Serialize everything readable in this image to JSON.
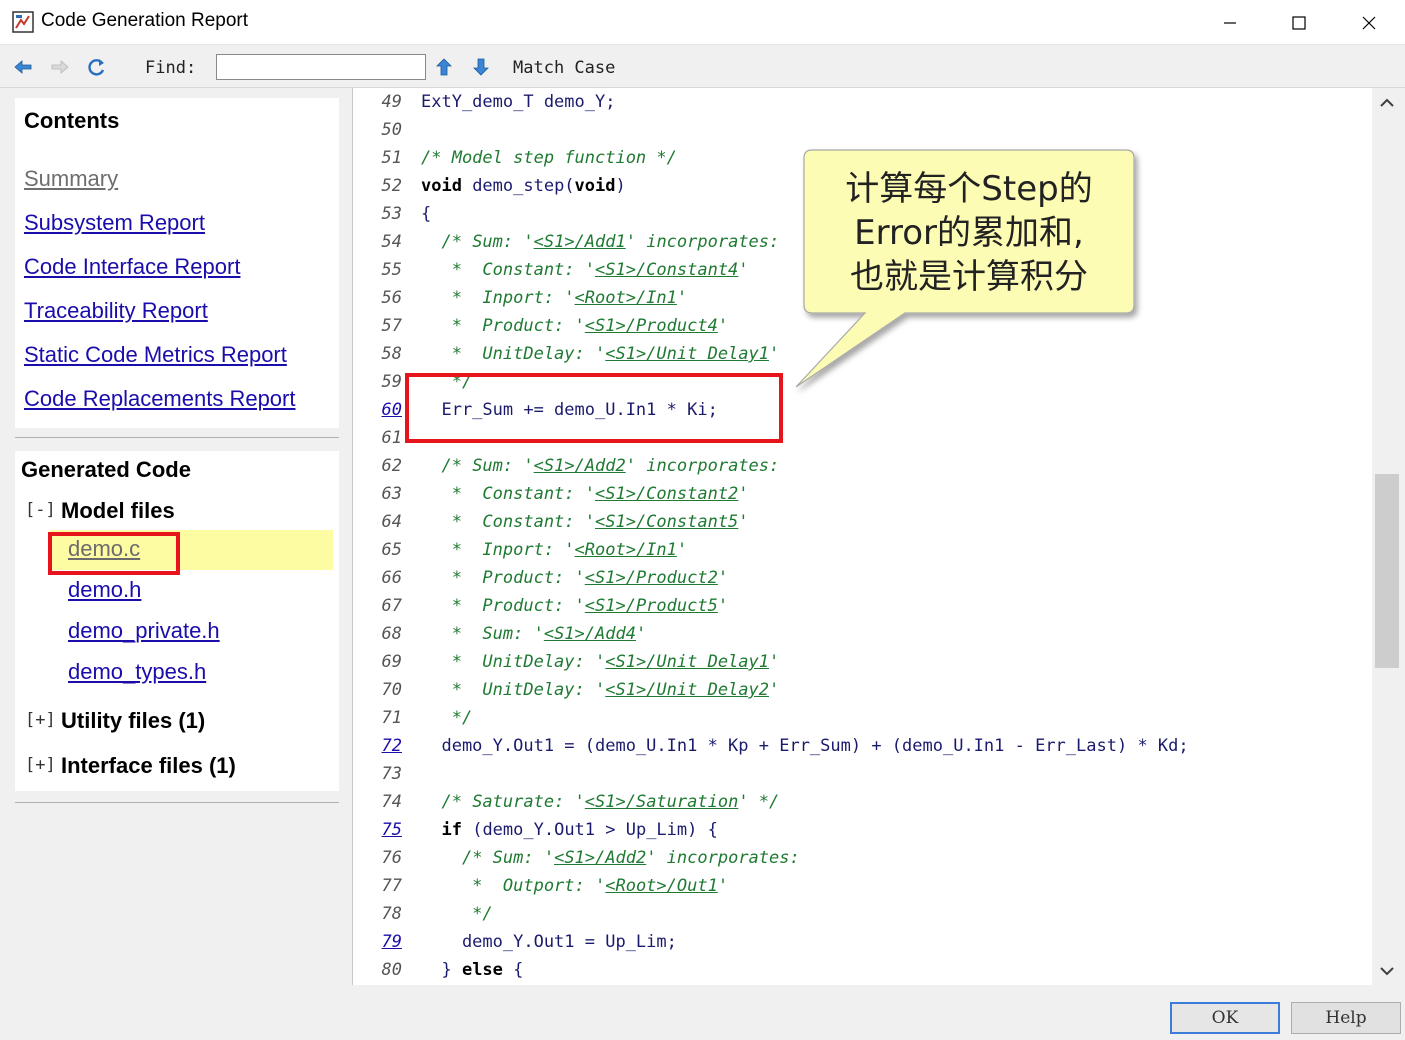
{
  "window": {
    "title": "Code Generation Report"
  },
  "toolbar": {
    "find_label": "Find:",
    "find_value": "",
    "match_case_label": "Match Case"
  },
  "contents": {
    "heading": "Contents",
    "links": [
      {
        "label": "Summary"
      },
      {
        "label": "Subsystem Report"
      },
      {
        "label": "Code Interface Report"
      },
      {
        "label": "Traceability Report"
      },
      {
        "label": "Static Code Metrics Report"
      },
      {
        "label": "Code Replacements Report"
      }
    ]
  },
  "generated_code": {
    "heading": "Generated Code",
    "model_files": {
      "toggle": "[-]",
      "label": "Model files",
      "files": [
        "demo.c",
        "demo.h",
        "demo_private.h",
        "demo_types.h"
      ]
    },
    "utility_files": {
      "toggle": "[+]",
      "label": "Utility files (1)"
    },
    "interface_files": {
      "toggle": "[+]",
      "label": "Interface files (1)"
    }
  },
  "code": {
    "lines": [
      {
        "n": "49",
        "link": false,
        "segs": [
          [
            "p",
            "ExtY_demo_T demo_Y;"
          ]
        ]
      },
      {
        "n": "50",
        "link": false,
        "segs": []
      },
      {
        "n": "51",
        "link": false,
        "segs": [
          [
            "c",
            "/* Model step function */"
          ]
        ]
      },
      {
        "n": "52",
        "link": false,
        "segs": [
          [
            "k",
            "void"
          ],
          [
            "p",
            " demo_step("
          ],
          [
            "k",
            "void"
          ],
          [
            "p",
            ")"
          ]
        ]
      },
      {
        "n": "53",
        "link": false,
        "segs": [
          [
            "p",
            "{"
          ]
        ]
      },
      {
        "n": "54",
        "link": false,
        "segs": [
          [
            "p",
            "  "
          ],
          [
            "c",
            "/* Sum: '"
          ],
          [
            "l",
            "<S1>/Add1"
          ],
          [
            "c",
            "' incorporates:"
          ]
        ]
      },
      {
        "n": "55",
        "link": false,
        "segs": [
          [
            "c",
            "   *  Constant: '"
          ],
          [
            "l",
            "<S1>/Constant4"
          ],
          [
            "c",
            "'"
          ]
        ]
      },
      {
        "n": "56",
        "link": false,
        "segs": [
          [
            "c",
            "   *  Inport: '"
          ],
          [
            "l",
            "<Root>/In1"
          ],
          [
            "c",
            "'"
          ]
        ]
      },
      {
        "n": "57",
        "link": false,
        "segs": [
          [
            "c",
            "   *  Product: '"
          ],
          [
            "l",
            "<S1>/Product4"
          ],
          [
            "c",
            "'"
          ]
        ]
      },
      {
        "n": "58",
        "link": false,
        "segs": [
          [
            "c",
            "   *  UnitDelay: '"
          ],
          [
            "l",
            "<S1>/Unit Delay1"
          ],
          [
            "c",
            "'"
          ]
        ]
      },
      {
        "n": "59",
        "link": false,
        "segs": [
          [
            "c",
            "   */"
          ]
        ]
      },
      {
        "n": "60",
        "link": true,
        "segs": [
          [
            "p",
            "  Err_Sum += demo_U.In1 * Ki;"
          ]
        ]
      },
      {
        "n": "61",
        "link": false,
        "segs": []
      },
      {
        "n": "62",
        "link": false,
        "segs": [
          [
            "p",
            "  "
          ],
          [
            "c",
            "/* Sum: '"
          ],
          [
            "l",
            "<S1>/Add2"
          ],
          [
            "c",
            "' incorporates:"
          ]
        ]
      },
      {
        "n": "63",
        "link": false,
        "segs": [
          [
            "c",
            "   *  Constant: '"
          ],
          [
            "l",
            "<S1>/Constant2"
          ],
          [
            "c",
            "'"
          ]
        ]
      },
      {
        "n": "64",
        "link": false,
        "segs": [
          [
            "c",
            "   *  Constant: '"
          ],
          [
            "l",
            "<S1>/Constant5"
          ],
          [
            "c",
            "'"
          ]
        ]
      },
      {
        "n": "65",
        "link": false,
        "segs": [
          [
            "c",
            "   *  Inport: '"
          ],
          [
            "l",
            "<Root>/In1"
          ],
          [
            "c",
            "'"
          ]
        ]
      },
      {
        "n": "66",
        "link": false,
        "segs": [
          [
            "c",
            "   *  Product: '"
          ],
          [
            "l",
            "<S1>/Product2"
          ],
          [
            "c",
            "'"
          ]
        ]
      },
      {
        "n": "67",
        "link": false,
        "segs": [
          [
            "c",
            "   *  Product: '"
          ],
          [
            "l",
            "<S1>/Product5"
          ],
          [
            "c",
            "'"
          ]
        ]
      },
      {
        "n": "68",
        "link": false,
        "segs": [
          [
            "c",
            "   *  Sum: '"
          ],
          [
            "l",
            "<S1>/Add4"
          ],
          [
            "c",
            "'"
          ]
        ]
      },
      {
        "n": "69",
        "link": false,
        "segs": [
          [
            "c",
            "   *  UnitDelay: '"
          ],
          [
            "l",
            "<S1>/Unit Delay1"
          ],
          [
            "c",
            "'"
          ]
        ]
      },
      {
        "n": "70",
        "link": false,
        "segs": [
          [
            "c",
            "   *  UnitDelay: '"
          ],
          [
            "l",
            "<S1>/Unit Delay2"
          ],
          [
            "c",
            "'"
          ]
        ]
      },
      {
        "n": "71",
        "link": false,
        "segs": [
          [
            "c",
            "   */"
          ]
        ]
      },
      {
        "n": "72",
        "link": true,
        "segs": [
          [
            "p",
            "  demo_Y.Out1 = (demo_U.In1 * Kp + Err_Sum) + (demo_U.In1 - Err_Last) * Kd;"
          ]
        ]
      },
      {
        "n": "73",
        "link": false,
        "segs": []
      },
      {
        "n": "74",
        "link": false,
        "segs": [
          [
            "p",
            "  "
          ],
          [
            "c",
            "/* Saturate: '"
          ],
          [
            "l",
            "<S1>/Saturation"
          ],
          [
            "c",
            "' */"
          ]
        ]
      },
      {
        "n": "75",
        "link": true,
        "segs": [
          [
            "p",
            "  "
          ],
          [
            "k",
            "if"
          ],
          [
            "p",
            " (demo_Y.Out1 > Up_Lim) {"
          ]
        ]
      },
      {
        "n": "76",
        "link": false,
        "segs": [
          [
            "p",
            "    "
          ],
          [
            "c",
            "/* Sum: '"
          ],
          [
            "l",
            "<S1>/Add2"
          ],
          [
            "c",
            "' incorporates:"
          ]
        ]
      },
      {
        "n": "77",
        "link": false,
        "segs": [
          [
            "c",
            "     *  Outport: '"
          ],
          [
            "l",
            "<Root>/Out1"
          ],
          [
            "c",
            "'"
          ]
        ]
      },
      {
        "n": "78",
        "link": false,
        "segs": [
          [
            "c",
            "     */"
          ]
        ]
      },
      {
        "n": "79",
        "link": true,
        "segs": [
          [
            "p",
            "    demo_Y.Out1 = Up_Lim;"
          ]
        ]
      },
      {
        "n": "80",
        "link": false,
        "segs": [
          [
            "p",
            "  } "
          ],
          [
            "k",
            "else"
          ],
          [
            "p",
            " {"
          ]
        ]
      }
    ]
  },
  "callout": {
    "line1": "计算每个Step的",
    "line2": "Error的累加和,",
    "line3": "也就是计算积分"
  },
  "buttons": {
    "ok": "OK",
    "help": "Help"
  },
  "colors": {
    "link": "#1a0dab",
    "comment": "#1f7a32",
    "highlight": "#fdfca3",
    "annotation_red": "#e8141c",
    "callout_fill": "#fdfcb4"
  }
}
